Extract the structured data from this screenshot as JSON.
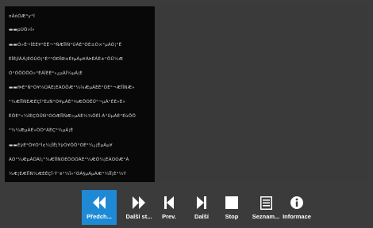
{
  "text_panel": {
    "lines": [
      "¤ÃôÕÆ°y°Í",
      "▬▬pÚÖ»Í»",
      "▬▬Õ»Ê¬ÌÈÈ¥°ÈÊ¬°ÑÆÏÌÑ°ÙÁÈ°ÕÈ±Ò×°µÁÕ¦°Ê",
      "ÈÎÈjÌÁÁ¦ÈÓÙÕ¦°È°°ÕÐÏØ±ÈfµÁµ¥ÁÞÈÁÈ±°ÔÜ¼Æ",
      "Ó°ÕÖÕÖÕ»°ÈÁÎÈÈ°»¿µÁÎ¼µÁ¦È",
      "▬▬fÞÈ°Ñ°Ó¥¼ÛÁÈ¦ÈÁÕÖÆ°¼¾ÆµÁÈÈ°ÕÈ°¬ÆÏÎÑÆ»",
      "°¼ÆÏÎÑÈÆÉÇÌ°ÈzÑ°Ó¥µÁÈ°¾ÆÖÕÊÜ°¬µÁ°ÉÈ»È»",
      "ÈÖÈ°»¼ÌÈÇÓÜÑ°ÓÓÆÏÎÑÆ»µÁÈ¼¾ÔÈÌ·Á°ÙµÁÈ°ÉùÖÖ",
      "°¼¼ÆµÁÈ»ÕÒ°ÁÈÇ°¼µÁ¦È",
      "▬▬ÉÿÈ°Ö¥Ó°Ì¢¼¦ÏÊ¦ÝÿÕ¥ÔÖ°ÓÈ°¼¿¦ÊµÁµ¥",
      "ÁÓ°¼ÆµÁÕÁÍ¡°¼ÆÏÎÑÕÉÔÕÓÁÈ°¼ÆÔ¼¦ÈÁÓÕÆ°Á",
      "¼Æ¦ÈÆÏÎÑ¼ÆÈÊÇÏ·Ý¨ë°¼Ï»°ÕÁ§µÁµÁÆ°¼ÏÏ¦È°¼Ý"
    ]
  },
  "toolbar": {
    "buttons": [
      {
        "label": "Předch...",
        "icon": "rewind-icon",
        "active": true
      },
      {
        "label": "Další st...",
        "icon": "fast-forward-icon",
        "active": false
      },
      {
        "label": "Prev.",
        "icon": "previous-icon",
        "active": false
      },
      {
        "label": "Další",
        "icon": "next-icon",
        "active": false
      },
      {
        "label": "Stop",
        "icon": "stop-icon",
        "active": false
      },
      {
        "label": "Seznam...",
        "icon": "list-icon",
        "active": false
      },
      {
        "label": "Informace",
        "icon": "info-icon",
        "active": false
      }
    ]
  },
  "colors": {
    "background": "#3b3b3b",
    "text_panel_background": "#080808",
    "active_button": "#1e8ad6",
    "icon_color": "#ffffff"
  }
}
